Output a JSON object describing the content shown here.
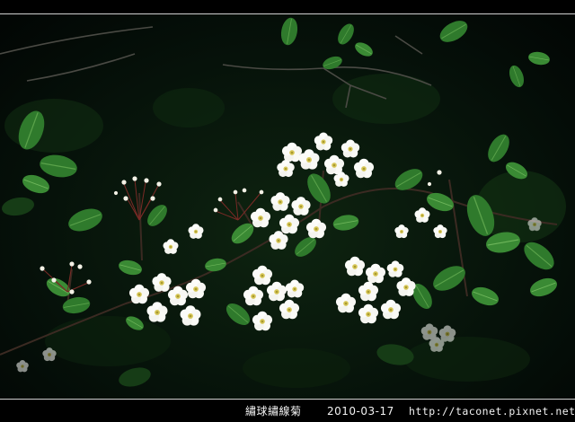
{
  "caption": {
    "title": "繡球繡線菊",
    "date": "2010-03-17",
    "url": "http://taconet.pixnet.net"
  },
  "colors": {
    "background": "#000000",
    "foliage": "#2f6b2a",
    "petals": "#ffffff",
    "flower_centers": "#d8c85a",
    "caption_text": "#f2f2f2",
    "rule": "#cfcfcf"
  }
}
